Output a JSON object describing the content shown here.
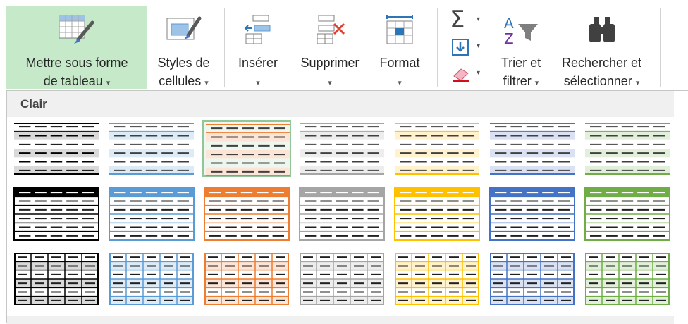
{
  "ribbon": {
    "format_as_table": {
      "line1": "Mettre sous forme",
      "line2": "de tableau",
      "caret": "▾",
      "icon": "table-brush-icon"
    },
    "cell_styles": {
      "line1": "Styles de",
      "line2": "cellules",
      "caret": "▾",
      "icon": "cell-styles-icon"
    },
    "insert": {
      "line1": "Insérer",
      "caret": "▾",
      "icon": "insert-cells-icon"
    },
    "delete": {
      "line1": "Supprimer",
      "caret": "▾",
      "icon": "delete-cells-icon"
    },
    "format": {
      "line1": "Format",
      "caret": "▾",
      "icon": "format-cells-icon"
    },
    "autosum": {
      "glyph": "Σ",
      "caret": "▾",
      "icon": "autosum-icon"
    },
    "fill": {
      "caret": "▾",
      "icon": "fill-down-icon"
    },
    "clear": {
      "caret": "▾",
      "icon": "eraser-icon"
    },
    "sort_filter": {
      "line1": "Trier et",
      "line2": "filtrer",
      "caret": "▾",
      "icon": "sort-filter-icon"
    },
    "find_select": {
      "line1": "Rechercher et",
      "line2": "sélectionner",
      "caret": "▾",
      "icon": "binoculars-icon"
    }
  },
  "gallery": {
    "section_light": "Clair",
    "palette": [
      {
        "main": "#000000",
        "light": "#d9d9d9"
      },
      {
        "main": "#5b9bd5",
        "light": "#ddebf7"
      },
      {
        "main": "#ed7d31",
        "light": "#fce4d6"
      },
      {
        "main": "#a5a5a5",
        "light": "#ededed"
      },
      {
        "main": "#ffc000",
        "light": "#fff2cc"
      },
      {
        "main": "#4472c4",
        "light": "#d9e1f2"
      },
      {
        "main": "#70ad47",
        "light": "#e2efda"
      }
    ],
    "rows": [
      {
        "style": "stripe",
        "names": [
          "Style de tableau clair 1",
          "Style de tableau clair 2",
          "Style de tableau clair 3",
          "Style de tableau clair 4",
          "Style de tableau clair 5",
          "Style de tableau clair 6",
          "Style de tableau clair 7"
        ]
      },
      {
        "style": "header",
        "names": [
          "Style de tableau clair 8",
          "Style de tableau clair 9",
          "Style de tableau clair 10",
          "Style de tableau clair 11",
          "Style de tableau clair 12",
          "Style de tableau clair 13",
          "Style de tableau clair 14"
        ]
      },
      {
        "style": "grid",
        "names": [
          "Style de tableau clair 15",
          "Style de tableau clair 16",
          "Style de tableau clair 17",
          "Style de tableau clair 18",
          "Style de tableau clair 19",
          "Style de tableau clair 20",
          "Style de tableau clair 21"
        ]
      }
    ],
    "selected": {
      "row": 0,
      "col": 2
    }
  }
}
